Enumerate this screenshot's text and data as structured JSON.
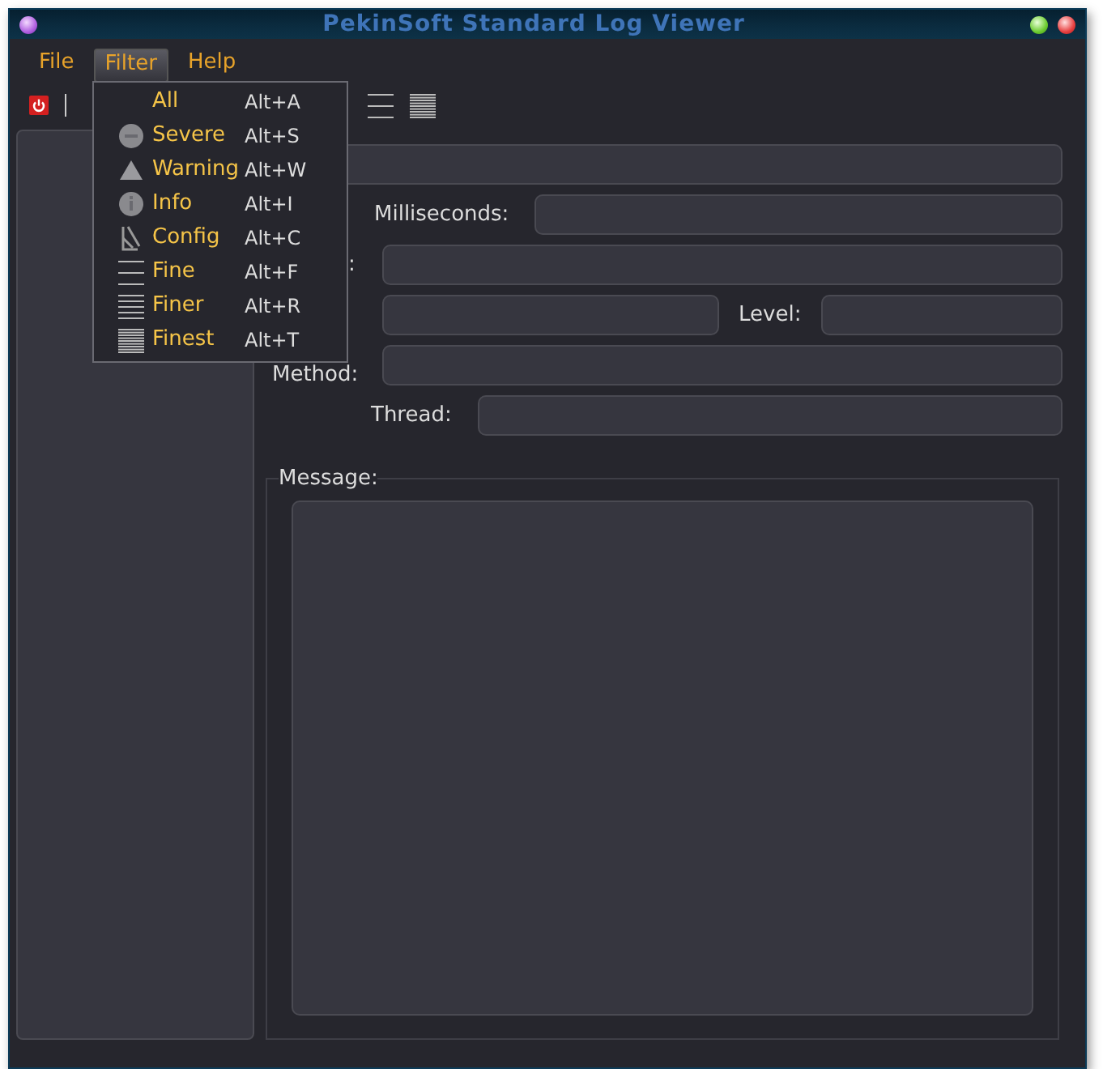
{
  "window": {
    "title": "PekinSoft Standard Log Viewer"
  },
  "menu_bar": [
    {
      "label": "File",
      "selected": false
    },
    {
      "label": "Filter",
      "selected": true
    },
    {
      "label": "Help",
      "selected": false
    }
  ],
  "toolbar": [
    {
      "kind": "power"
    },
    {
      "kind": "separator"
    },
    {
      "kind": "fine"
    },
    {
      "kind": "finest"
    }
  ],
  "filter_menu": [
    {
      "label": "All",
      "shortcut": "Alt+A",
      "kind": "none"
    },
    {
      "label": "Severe",
      "shortcut": "Alt+S",
      "kind": "severe"
    },
    {
      "label": "Warning",
      "shortcut": "Alt+W",
      "kind": "warning"
    },
    {
      "label": "Info",
      "shortcut": "Alt+I",
      "kind": "info"
    },
    {
      "label": "Config",
      "shortcut": "Alt+C",
      "kind": "config"
    },
    {
      "label": "Fine",
      "shortcut": "Alt+F",
      "kind": "fine"
    },
    {
      "label": "Finer",
      "shortcut": "Alt+R",
      "kind": "finer"
    },
    {
      "label": "Finest",
      "shortcut": "Alt+T",
      "kind": "finest"
    }
  ],
  "details": {
    "rows": [
      {
        "fields": [
          {
            "kind": "text"
          }
        ]
      },
      {
        "fields": [
          {
            "kind": "text",
            "label": "Milliseconds:"
          }
        ]
      },
      {
        "fields": [
          {
            "kind": "text",
            "label": ":"
          }
        ]
      },
      {
        "fields": [
          {
            "kind": "text"
          },
          {
            "kind": "text",
            "label": "Level:"
          }
        ]
      },
      {
        "fields": [
          {
            "kind": "text",
            "label": "Method:"
          }
        ]
      },
      {
        "fields": [
          {
            "kind": "text",
            "label": "Thread:"
          }
        ]
      }
    ],
    "message": {
      "label": "Message:"
    }
  }
}
